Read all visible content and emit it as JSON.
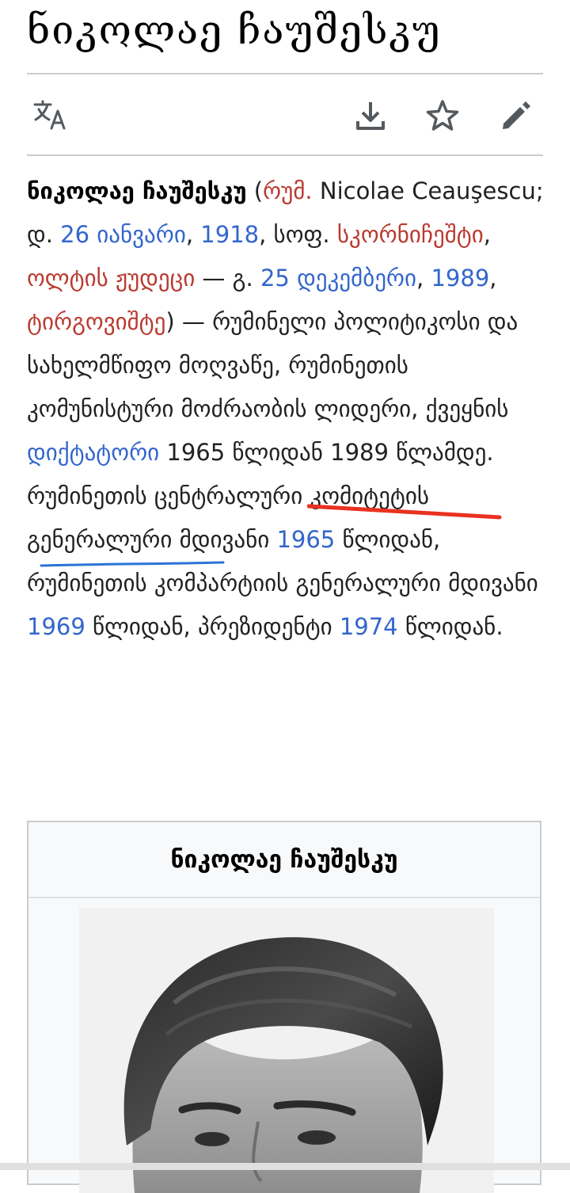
{
  "article": {
    "title": "ნიკოლაე ჩაუშესკუ"
  },
  "toolbar": {
    "language_icon": "translate-icon",
    "download_icon": "download-icon",
    "watch_icon": "star-icon",
    "edit_icon": "pencil-icon"
  },
  "lead": {
    "name_bold": "ნიკოლაე ჩაუშესკუ",
    "open_paren": " (",
    "lang_abbr": "რუმ.",
    "native_name": " Nicolae Ceauşescu; დ. ",
    "birth_day": "26 იანვარი",
    "comma1": ", ",
    "birth_year": "1918",
    "village_prefix": ", სოფ. ",
    "birth_village": "სკორნიჩეშტი",
    "comma2": ", ",
    "birth_county": "ოლტის ჟუდეცი",
    "death_prefix": " — გ. ",
    "death_day": "25 დეკემბერი",
    "comma3": ", ",
    "death_year": "1989",
    "comma4": ", ",
    "death_place": "ტირგოვიშტე",
    "after_death": ") — რუმინელი პოლიტიკოსი და სახელმწიფო მოღვაწე, რუმინეთის კომუნისტური მოძრაობის ლიდერი, ქვეყნის ",
    "dictator": "დიქტატორი",
    "dictator_span": " 1965 წლიდან 1989 წლამდე.",
    "sec_prefix": " რუმინეთის ცენტრალური კომიტეტის გენერალური მდივანი ",
    "sec_year": "1965",
    "sec_suffix": " წლიდან, რუმინეთის კომპარტიის გენერალური მდივანი ",
    "party_year": "1969",
    "party_suffix": " წლიდან, პრეზიდენტი ",
    "pres_year": "1974",
    "pres_suffix": " წლიდან."
  },
  "colors": {
    "link": "#3366cc",
    "redlink": "#ba3a30",
    "annotation_red": "#e8321f",
    "annotation_blue": "#2a74d6"
  },
  "infobox": {
    "title": "ნიკოლაე ჩაუშესკუ",
    "image": "portrait-photo"
  }
}
